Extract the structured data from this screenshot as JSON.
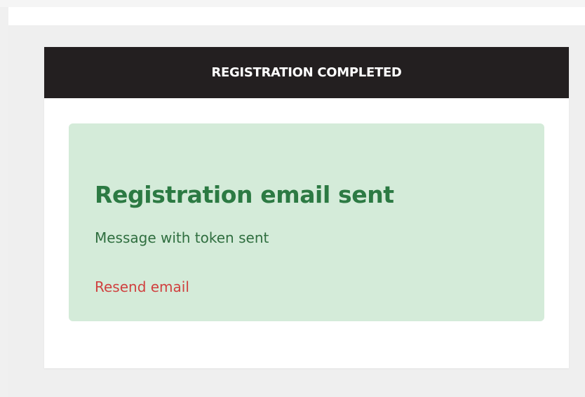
{
  "card": {
    "header_title": "REGISTRATION COMPLETED"
  },
  "alert": {
    "title": "Registration email sent",
    "message": "Message with token sent",
    "resend_link": "Resend email"
  },
  "colors": {
    "page_background": "#f0f0f0",
    "header_background": "#231f20",
    "alert_background": "#d4ebd9",
    "alert_text": "#2c7a43",
    "link_text": "#d0403f"
  }
}
